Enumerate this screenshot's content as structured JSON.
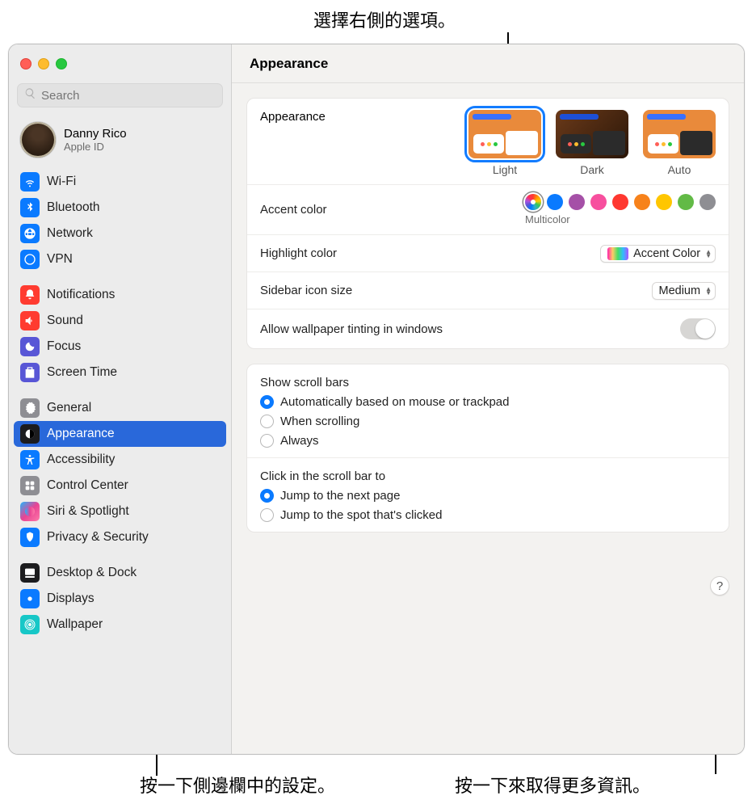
{
  "callouts": {
    "top": "選擇右側的選項。",
    "bottom_left": "按一下側邊欄中的設定。",
    "bottom_right": "按一下來取得更多資訊。"
  },
  "search": {
    "placeholder": "Search"
  },
  "account": {
    "name": "Danny Rico",
    "sub": "Apple ID"
  },
  "sidebar": {
    "groups": [
      {
        "items": [
          {
            "id": "wifi",
            "label": "Wi-Fi",
            "bg": "#0a7aff"
          },
          {
            "id": "bluetooth",
            "label": "Bluetooth",
            "bg": "#0a7aff"
          },
          {
            "id": "network",
            "label": "Network",
            "bg": "#0a7aff"
          },
          {
            "id": "vpn",
            "label": "VPN",
            "bg": "#0a7aff"
          }
        ]
      },
      {
        "items": [
          {
            "id": "notifications",
            "label": "Notifications",
            "bg": "#ff3b30"
          },
          {
            "id": "sound",
            "label": "Sound",
            "bg": "#ff3b30"
          },
          {
            "id": "focus",
            "label": "Focus",
            "bg": "#5856d6"
          },
          {
            "id": "screentime",
            "label": "Screen Time",
            "bg": "#5856d6"
          }
        ]
      },
      {
        "items": [
          {
            "id": "general",
            "label": "General",
            "bg": "#8e8e93"
          },
          {
            "id": "appearance",
            "label": "Appearance",
            "bg": "#1c1c1e",
            "selected": true
          },
          {
            "id": "accessibility",
            "label": "Accessibility",
            "bg": "#0a7aff"
          },
          {
            "id": "controlcenter",
            "label": "Control Center",
            "bg": "#8e8e93"
          },
          {
            "id": "siri",
            "label": "Siri & Spotlight",
            "bg": "linear-gradient(135deg,#1fb6ff,#e84393,#fd79a8)"
          },
          {
            "id": "privacy",
            "label": "Privacy & Security",
            "bg": "#0a7aff"
          }
        ]
      },
      {
        "items": [
          {
            "id": "desktop",
            "label": "Desktop & Dock",
            "bg": "#1c1c1e"
          },
          {
            "id": "displays",
            "label": "Displays",
            "bg": "#0a7aff"
          },
          {
            "id": "wallpaper",
            "label": "Wallpaper",
            "bg": "#17c7c7"
          }
        ]
      }
    ]
  },
  "header": {
    "title": "Appearance"
  },
  "appearance_section": {
    "label": "Appearance",
    "options": [
      {
        "id": "light",
        "label": "Light",
        "selected": true
      },
      {
        "id": "dark",
        "label": "Dark"
      },
      {
        "id": "auto",
        "label": "Auto"
      }
    ]
  },
  "accent": {
    "label": "Accent color",
    "selected_label": "Multicolor",
    "colors": [
      "multi",
      "#0a7aff",
      "#a550a7",
      "#f74f9e",
      "#ff3830",
      "#f7821b",
      "#ffc600",
      "#62ba46",
      "#8e8e93"
    ]
  },
  "highlight": {
    "label": "Highlight color",
    "value": "Accent Color"
  },
  "sidebar_size": {
    "label": "Sidebar icon size",
    "value": "Medium"
  },
  "wallpaper_tint": {
    "label": "Allow wallpaper tinting in windows",
    "value": true
  },
  "scrollbars": {
    "title": "Show scroll bars",
    "options": [
      "Automatically based on mouse or trackpad",
      "When scrolling",
      "Always"
    ],
    "selected": 0
  },
  "scrollclick": {
    "title": "Click in the scroll bar to",
    "options": [
      "Jump to the next page",
      "Jump to the spot that's clicked"
    ],
    "selected": 0
  },
  "help": "?"
}
